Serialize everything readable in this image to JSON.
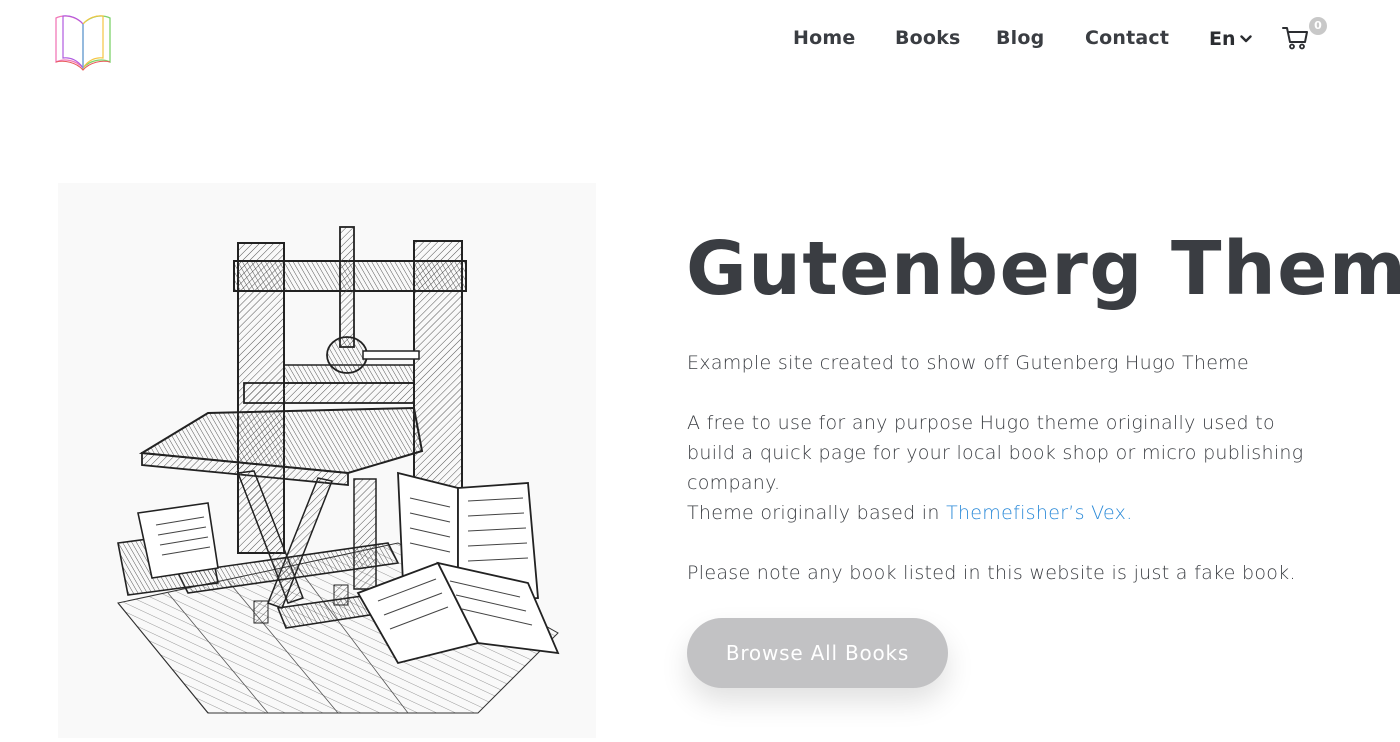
{
  "nav": {
    "items": [
      {
        "label": "Home"
      },
      {
        "label": "Books"
      },
      {
        "label": "Blog"
      },
      {
        "label": "Contact"
      }
    ],
    "language": "En",
    "cart_count": "0"
  },
  "hero": {
    "title": "Gutenberg Theme",
    "paragraph1": "Example site created to show off Gutenberg Hugo Theme",
    "paragraph2": "A free to use for any purpose Hugo theme originally used to build a quick page for your local book shop or micro publishing company.",
    "paragraph3_prefix": "Theme originally based in ",
    "paragraph3_link": "Themefisher’s Vex.",
    "paragraph4": "Please note any book listed in this website is just a fake book.",
    "button_label": "Browse All Books"
  },
  "colors": {
    "text": "#3a3d42",
    "link": "#2b8ad8",
    "button": "#c2c2c4",
    "badge": "#c8c8c8"
  },
  "icons": [
    "book-logo-icon",
    "chevron-down-icon",
    "cart-icon"
  ]
}
